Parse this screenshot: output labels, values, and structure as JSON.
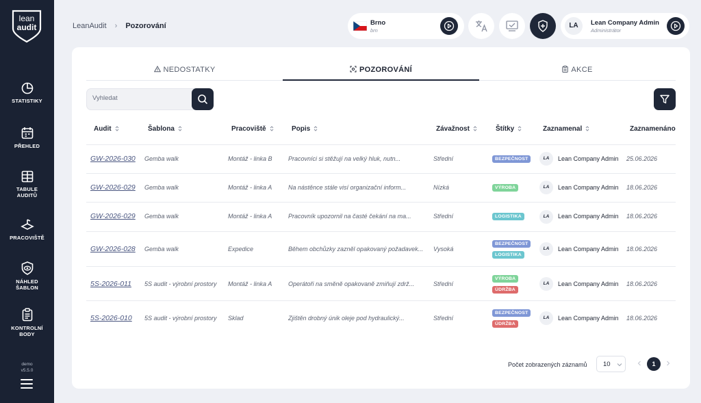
{
  "sidebar": {
    "logo_top": "lean",
    "logo_bottom": "audit",
    "items": [
      {
        "label": "STATISTIKY"
      },
      {
        "label": "PŘEHLED"
      },
      {
        "label_line1": "TABULE",
        "label_line2": "AUDITŮ"
      },
      {
        "label": "PRACOVIŠTĚ"
      },
      {
        "label_line1": "NÁHLED",
        "label_line2": "ŠABLON"
      },
      {
        "label_line1": "KONTROLNÍ",
        "label_line2": "BODY"
      }
    ],
    "env": "demo",
    "version": "v5.5.0"
  },
  "breadcrumb": {
    "root": "LeanAudit",
    "separator": "›",
    "current": "Pozorování"
  },
  "location": {
    "name": "Brno",
    "code": "brn"
  },
  "user": {
    "initials": "LA",
    "name": "Lean Company Admin",
    "role": "Administrátor"
  },
  "tabs": [
    {
      "label": "NEDOSTATKY",
      "active": false
    },
    {
      "label": "POZOROVÁNÍ",
      "active": true
    },
    {
      "label": "AKCE",
      "active": false
    }
  ],
  "search": {
    "placeholder": "Vyhledat",
    "value": ""
  },
  "table": {
    "columns": [
      "Audit",
      "Šablona",
      "Pracoviště",
      "Popis",
      "Závažnost",
      "Štítky",
      "Zaznamenal",
      "Zaznamenáno"
    ],
    "rows": [
      {
        "audit": "GW-2026-030",
        "template": "Gemba walk",
        "workplace": "Montáž - linka B",
        "description": "Pracovníci si stěžují na velký hluk, nutn...",
        "severity": "Střední",
        "tags": [
          "BEZPEČNOST"
        ],
        "recorder_initials": "LA",
        "recorder": "Lean Company Admin",
        "date": "25.06.2026"
      },
      {
        "audit": "GW-2026-029",
        "template": "Gemba walk",
        "workplace": "Montáž - linka A",
        "description": "Na nástěnce stále visí organizační inform...",
        "severity": "Nízká",
        "tags": [
          "VÝROBA"
        ],
        "recorder_initials": "LA",
        "recorder": "Lean Company Admin",
        "date": "18.06.2026"
      },
      {
        "audit": "GW-2026-029",
        "template": "Gemba walk",
        "workplace": "Montáž - linka A",
        "description": "Pracovník upozornil na časté čekání na ma...",
        "severity": "Střední",
        "tags": [
          "LOGISTIKA"
        ],
        "recorder_initials": "LA",
        "recorder": "Lean Company Admin",
        "date": "18.06.2026"
      },
      {
        "audit": "GW-2026-028",
        "template": "Gemba walk",
        "workplace": "Expedice",
        "description": "Během obchůzky zazněl opakovaný požadavek...",
        "severity": "Vysoká",
        "tags": [
          "BEZPEČNOST",
          "LOGISTIKA"
        ],
        "recorder_initials": "LA",
        "recorder": "Lean Company Admin",
        "date": "18.06.2026"
      },
      {
        "audit": "5S-2026-011",
        "template": "5S audit - výrobní prostory",
        "workplace": "Montáž - linka A",
        "description": "Operátoři na směně opakovaně zmiňují zdrž...",
        "severity": "Střední",
        "tags": [
          "VÝROBA",
          "ÚDRŽBA"
        ],
        "recorder_initials": "LA",
        "recorder": "Lean Company Admin",
        "date": "18.06.2026"
      },
      {
        "audit": "5S-2026-010",
        "template": "5S audit - výrobní prostory",
        "workplace": "Sklad",
        "description": "Zjištěn drobný únik oleje pod hydraulický...",
        "severity": "Střední",
        "tags": [
          "BEZPEČNOST",
          "ÚDRŽBA"
        ],
        "recorder_initials": "LA",
        "recorder": "Lean Company Admin",
        "date": "18.06.2026"
      }
    ]
  },
  "tag_colors": {
    "BEZPEČNOST": "#7f97d6",
    "VÝROBA": "#7fd49a",
    "LOGISTIKA": "#6cc6cf",
    "ÚDRŽBA": "#de6b6b"
  },
  "pagination": {
    "label": "Počet zobrazených záznamů",
    "page_size": "10",
    "current_page": "1"
  },
  "colors": {
    "sidebar": "#1a2233",
    "accent": "#1f2738",
    "background": "#eef0f5"
  }
}
